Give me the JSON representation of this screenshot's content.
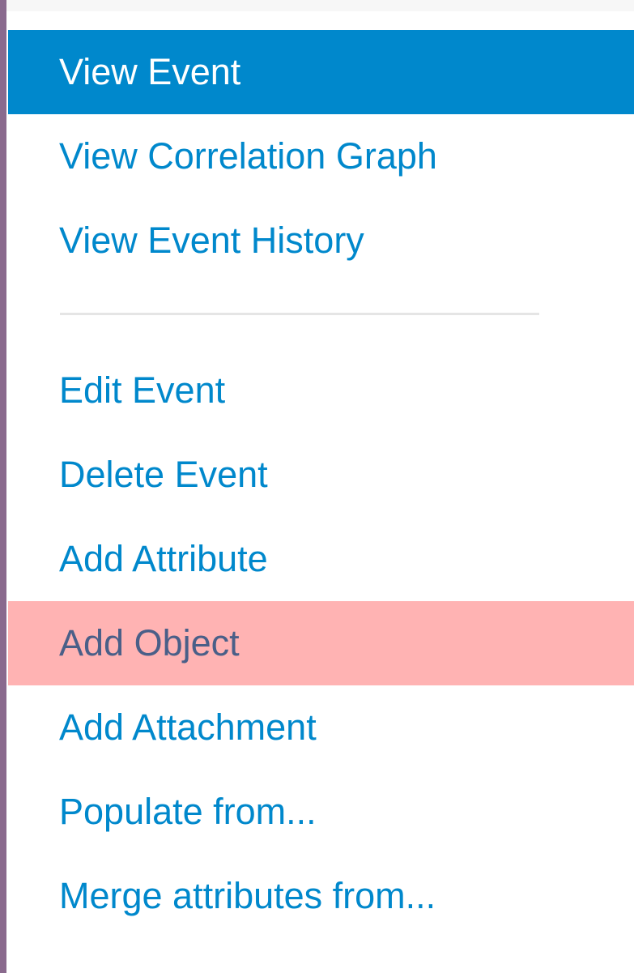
{
  "menu": {
    "items": [
      {
        "label": "View Event",
        "state": "active"
      },
      {
        "label": "View Correlation Graph",
        "state": "normal"
      },
      {
        "label": "View Event History",
        "state": "normal"
      },
      {
        "label": "Edit Event",
        "state": "normal"
      },
      {
        "label": "Delete Event",
        "state": "normal"
      },
      {
        "label": "Add Attribute",
        "state": "normal"
      },
      {
        "label": "Add Object",
        "state": "highlighted"
      },
      {
        "label": "Add Attachment",
        "state": "normal"
      },
      {
        "label": "Populate from...",
        "state": "normal"
      },
      {
        "label": "Merge attributes from...",
        "state": "normal"
      }
    ]
  },
  "colors": {
    "link": "#0088cc",
    "active_background": "#0088cc",
    "active_text": "#ffffff",
    "highlight_background": "#ffb3b3",
    "highlight_text": "#4a5f88",
    "divider": "#e5e5e5",
    "left_border": "#8a6a8e"
  }
}
